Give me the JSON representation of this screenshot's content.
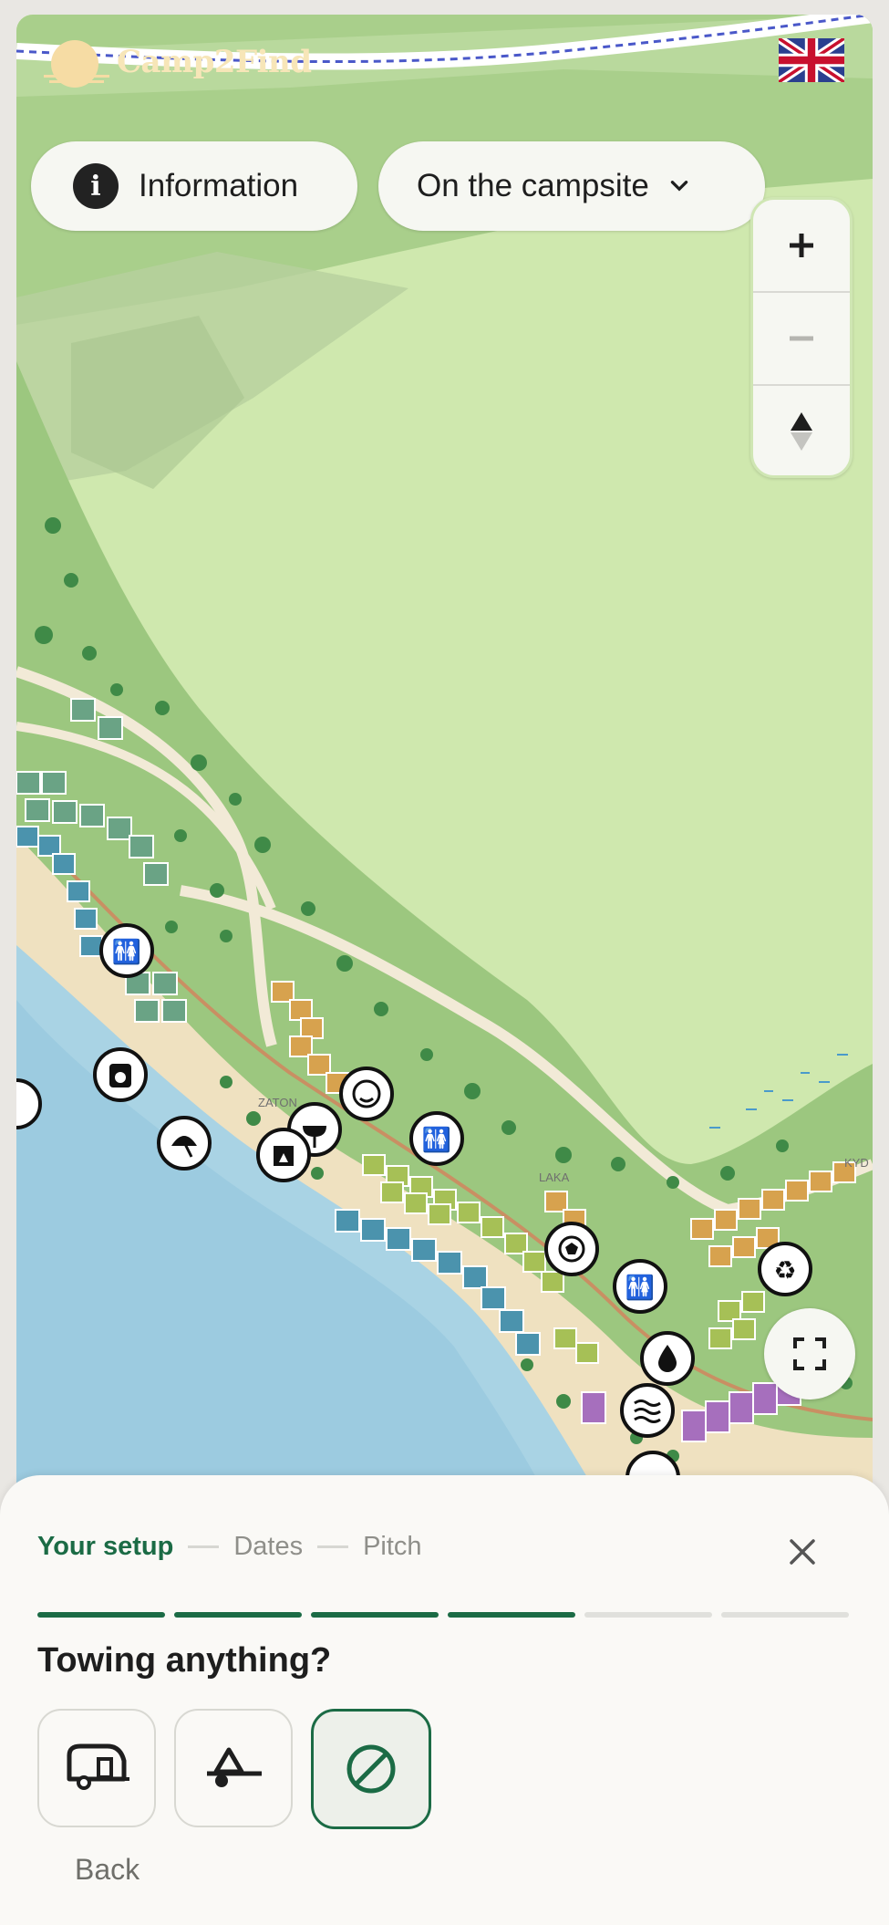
{
  "app": {
    "brand": "Camp2Find",
    "language_flag": "United Kingdom"
  },
  "header": {
    "info_label": "Information",
    "area_label": "On the campsite"
  },
  "map": {
    "place_labels": [
      "ZATON",
      "LAKA",
      "KYD"
    ],
    "facility_icons": [
      "toilets-icon",
      "laundry-icon",
      "beach-umbrella-icon",
      "bbq-icon",
      "restaurant-icon",
      "kids-club-icon",
      "toilets-icon",
      "sports-icon",
      "toilets-icon",
      "recycling-icon",
      "water-icon",
      "pool-icon",
      "shop-icon"
    ]
  },
  "booking": {
    "steps": [
      {
        "label": "Your setup",
        "active": true
      },
      {
        "label": "Dates",
        "active": false
      },
      {
        "label": "Pitch",
        "active": false
      }
    ],
    "progress": {
      "completed": 4,
      "total": 6
    },
    "question": "Towing anything?",
    "options": [
      {
        "icon": "caravan-icon",
        "selected": false
      },
      {
        "icon": "trailer-icon",
        "selected": false
      },
      {
        "icon": "none-icon",
        "selected": true
      }
    ],
    "back_label": "Back"
  },
  "colors": {
    "accent": "#1b6b45",
    "sheet": "#faf9f6",
    "map_green": "#cfe8ae",
    "water": "#a9d3e4"
  }
}
